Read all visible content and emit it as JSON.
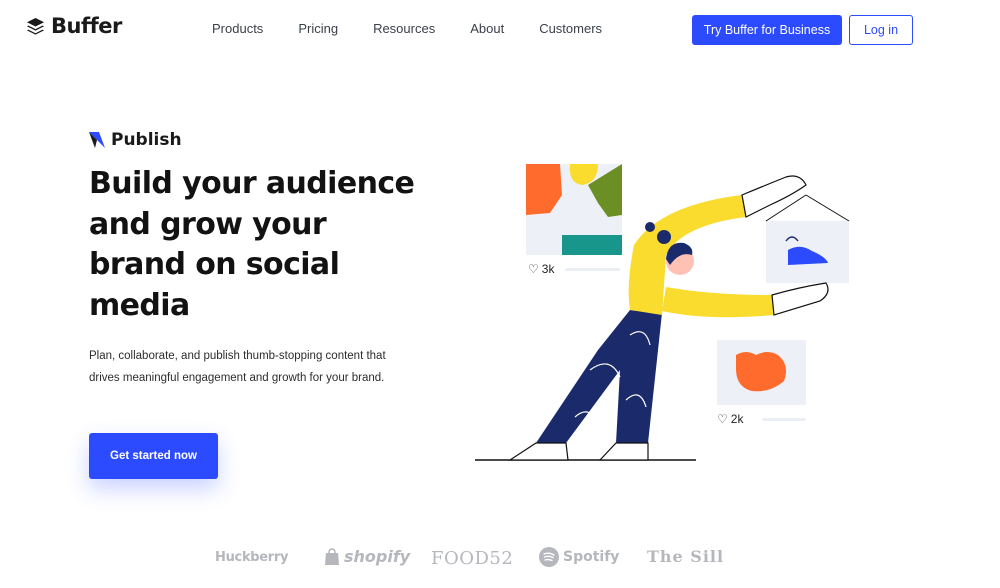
{
  "header": {
    "logo_text": "Buffer",
    "nav": [
      {
        "label": "Products"
      },
      {
        "label": "Pricing"
      },
      {
        "label": "Resources"
      },
      {
        "label": "About"
      },
      {
        "label": "Customers"
      }
    ],
    "primary_button": "Try Buffer for Business",
    "login_button": "Log in"
  },
  "hero": {
    "product_label": "Publish",
    "headline": "Build your audience and grow your brand on social media",
    "subtext": "Plan, collaborate, and publish thumb-stopping content that drives meaningful engagement and growth for your brand.",
    "cta": "Get started now",
    "likes": [
      {
        "count": "3k"
      },
      {
        "count": "2k"
      }
    ]
  },
  "logos": [
    {
      "name": "Huckberry"
    },
    {
      "name": "shopify"
    },
    {
      "name": "FOOD52"
    },
    {
      "name": "Spotify"
    },
    {
      "name": "The Sill"
    }
  ],
  "colors": {
    "accent": "#2c4bff",
    "illustration_yellow": "#f9dc2e",
    "illustration_navy": "#1b2a6b",
    "logo_gray": "#b5b7bd"
  }
}
